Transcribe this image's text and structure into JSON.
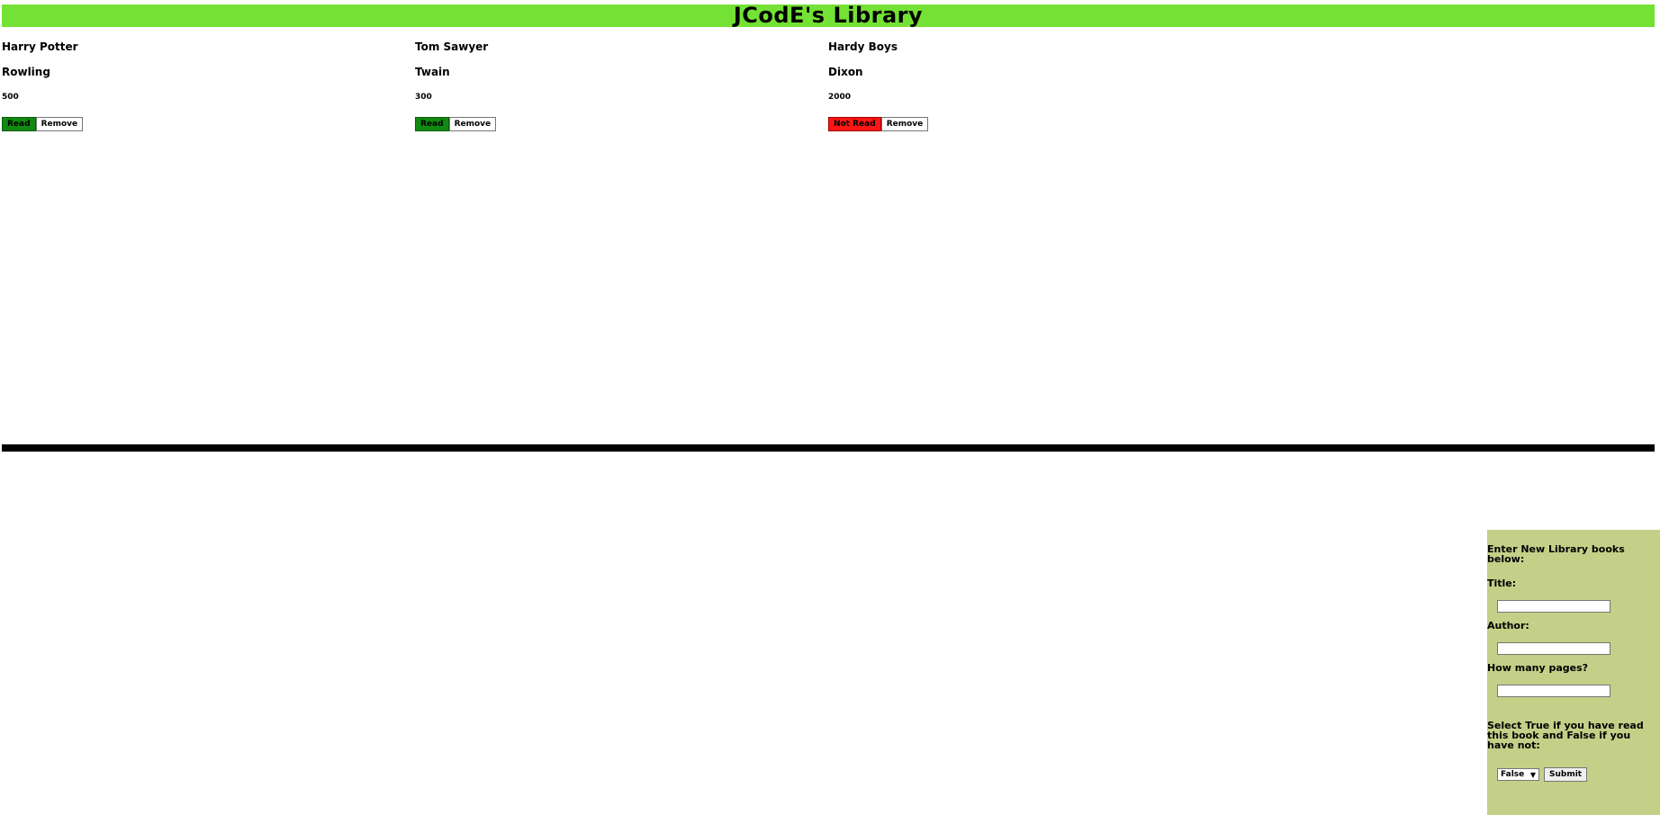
{
  "header": {
    "title": "JCodE's Library"
  },
  "books": [
    {
      "title": "Harry Potter",
      "author": "Rowling",
      "pages": "500",
      "status_label": "Read",
      "status": "read",
      "remove_label": "Remove"
    },
    {
      "title": "Tom Sawyer",
      "author": "Twain",
      "pages": "300",
      "status_label": "Read",
      "status": "read",
      "remove_label": "Remove"
    },
    {
      "title": "Hardy Boys",
      "author": "Dixon",
      "pages": "2000",
      "status_label": "Not Read",
      "status": "not-read",
      "remove_label": "Remove"
    }
  ],
  "form": {
    "heading": "Enter New Library books below:",
    "title_label": "Title:",
    "title_value": "",
    "author_label": "Author:",
    "author_value": "",
    "pages_label": "How many pages?",
    "pages_value": "",
    "read_prompt": "Select True if you have read this book and False if you have not:",
    "read_selected": "False",
    "submit_label": "Submit"
  },
  "colors": {
    "header_bg": "#73e234",
    "read_button": "#118a11",
    "not_read_button": "#ff1515",
    "form_bg": "#c4cf88",
    "divider": "#000000"
  }
}
